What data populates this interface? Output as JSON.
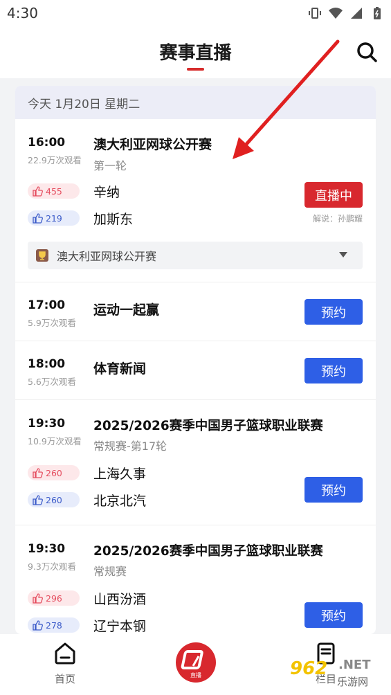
{
  "status_bar": {
    "time": "4:30"
  },
  "header": {
    "title": "赛事直播"
  },
  "date_bar": {
    "text": "今天  1月20日 星期二"
  },
  "items": [
    {
      "time": "16:00",
      "views": "22.9万次观看",
      "event": "澳大利亚网球公开赛",
      "round": "第一轮",
      "team1": {
        "name": "辛纳",
        "likes": "455"
      },
      "team2": {
        "name": "加斯东",
        "likes": "219"
      },
      "button": "直播中",
      "commentary": "解说：孙鹏耀",
      "dropdown": "澳大利亚网球公开赛"
    },
    {
      "time": "17:00",
      "views": "5.9万次观看",
      "event": "运动一起赢",
      "button": "预约"
    },
    {
      "time": "18:00",
      "views": "5.6万次观看",
      "event": "体育新闻",
      "button": "预约"
    },
    {
      "time": "19:30",
      "views": "10.9万次观看",
      "event": "2025/2026赛季中国男子篮球职业联赛",
      "round": "常规赛-第17轮",
      "team1": {
        "name": "上海久事",
        "likes": "260"
      },
      "team2": {
        "name": "北京北汽",
        "likes": "260"
      },
      "button": "预约"
    },
    {
      "time": "19:30",
      "views": "9.3万次观看",
      "event": "2025/2026赛季中国男子篮球职业联赛",
      "round": "常规赛",
      "team1": {
        "name": "山西汾酒",
        "likes": "296"
      },
      "team2": {
        "name": "辽宁本钢",
        "likes": "278"
      },
      "button": "预约"
    }
  ],
  "bottom_nav": {
    "home_label": "首页",
    "center_label": "直播",
    "right_label": "栏目"
  },
  "watermark": {
    "number": "962",
    "net": ".NET",
    "sub": "乐游网"
  },
  "colors": {
    "accent_red": "#d8282e",
    "accent_blue": "#2e5fe6"
  },
  "icons": [
    "signal-vibrate-icon",
    "wifi-icon",
    "cellular-icon",
    "battery-icon",
    "search-icon",
    "thumb-up-icon",
    "trophy-icon",
    "chevron-down-icon",
    "home-icon",
    "document-icon"
  ]
}
